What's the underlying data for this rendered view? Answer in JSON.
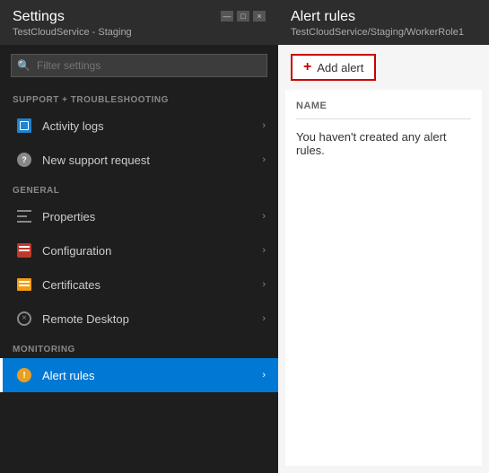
{
  "left_panel": {
    "title": "Settings",
    "subtitle": "TestCloudService - Staging",
    "search_placeholder": "Filter settings",
    "sections": [
      {
        "label": "Support + Troubleshooting",
        "items": [
          {
            "id": "activity-logs",
            "label": "Activity logs",
            "active": false
          },
          {
            "id": "new-support-request",
            "label": "New support request",
            "active": false
          }
        ]
      },
      {
        "label": "General",
        "items": [
          {
            "id": "properties",
            "label": "Properties",
            "active": false
          },
          {
            "id": "configuration",
            "label": "Configuration",
            "active": false
          },
          {
            "id": "certificates",
            "label": "Certificates",
            "active": false
          },
          {
            "id": "remote-desktop",
            "label": "Remote Desktop",
            "active": false
          }
        ]
      },
      {
        "label": "Monitoring",
        "items": [
          {
            "id": "alert-rules",
            "label": "Alert rules",
            "active": true
          }
        ]
      }
    ],
    "window_controls": [
      "—",
      "□",
      "×"
    ]
  },
  "right_panel": {
    "title": "Alert rules",
    "subtitle": "TestCloudService/Staging/WorkerRole1",
    "add_button_label": "Add alert",
    "column_header": "Name",
    "empty_message": "You haven't created any alert rules."
  }
}
